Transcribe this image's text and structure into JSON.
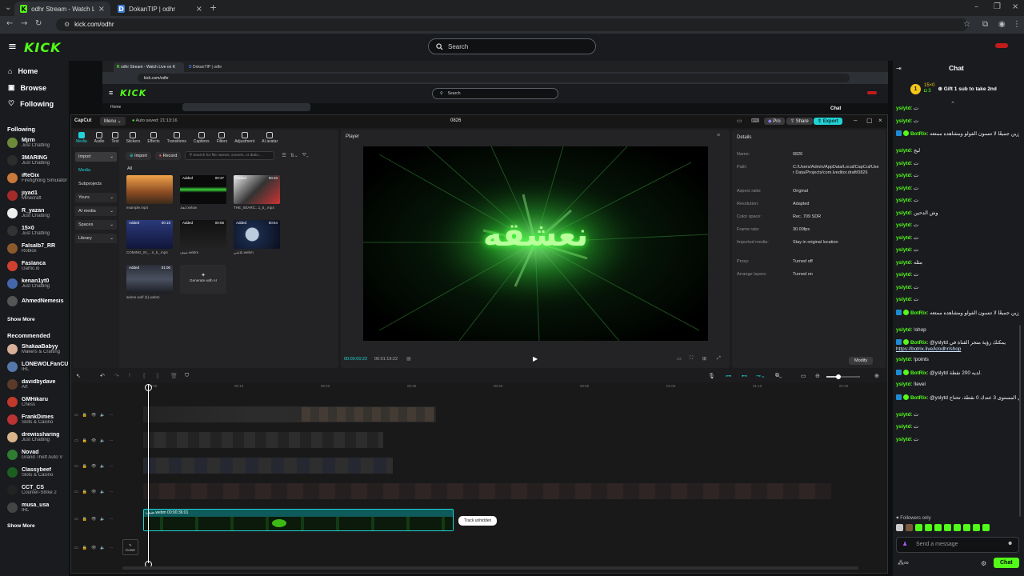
{
  "browser": {
    "tabs": [
      {
        "title": "odhr Stream - Watch Live on Kick",
        "active": true
      },
      {
        "title": "DokanTIP | odhr",
        "active": false
      }
    ],
    "url": "kick.com/odhr"
  },
  "kick": {
    "logo": "KICK",
    "search_placeholder": "Search",
    "nav": [
      "Home",
      "Browse",
      "Following"
    ],
    "following_title": "Following",
    "following": [
      {
        "name": "Mjrm",
        "category": "Just Chatting",
        "color": "#6d8a3a"
      },
      {
        "name": "3MARING",
        "category": "Just Chatting",
        "color": "#2c2c2c"
      },
      {
        "name": "iReGix",
        "category": "Firefighting Simulator",
        "color": "#c97a3a"
      },
      {
        "name": "jiyad1",
        "category": "Minecraft",
        "color": "#a52a2a"
      },
      {
        "name": "R_yazan",
        "category": "Just Chatting",
        "color": "#eeeeee"
      },
      {
        "name": "15×0",
        "category": "Just Chatting",
        "color": "#333333"
      },
      {
        "name": "Falsalb7_RR",
        "category": "Roblox",
        "color": "#8b5a2b"
      },
      {
        "name": "Faslanca",
        "category": "Gartic.io",
        "color": "#d04030"
      },
      {
        "name": "kenan1yt0",
        "category": "Just Chatting",
        "color": "#4466aa"
      },
      {
        "name": "AhmedNemesis",
        "category": "",
        "color": "#555555"
      }
    ],
    "show_more": "Show More",
    "recommended_title": "Recommended",
    "recommended": [
      {
        "name": "ShakaaBabyy",
        "category": "Makers & Crafting",
        "color": "#d8b09a"
      },
      {
        "name": "LONEWOLFanCU",
        "category": "IRL",
        "color": "#5577aa"
      },
      {
        "name": "davidbydave",
        "category": "Art",
        "color": "#5a3b2a"
      },
      {
        "name": "GMHikaru",
        "category": "Chess",
        "color": "#c0392b"
      },
      {
        "name": "FrankDimes",
        "category": "Slots & Casino",
        "color": "#bb3333"
      },
      {
        "name": "drewissharing",
        "category": "Just Chatting",
        "color": "#d9b58a"
      },
      {
        "name": "Novad",
        "category": "Grand Theft Auto V",
        "color": "#2e7d32"
      },
      {
        "name": "Classybeef",
        "category": "Slots & Casino",
        "color": "#1b5e20"
      },
      {
        "name": "CCT_CS",
        "category": "Counter-Strike 2",
        "color": "#222222"
      },
      {
        "name": "musa_usa",
        "category": "IRL",
        "color": "#444444"
      }
    ],
    "show_more_2": "Show More"
  },
  "inner": {
    "tabs": [
      "odhr Stream - Watch Live on K",
      "DokanTIP | odhr"
    ],
    "url": "kick.com/odhr",
    "search": "Search",
    "home": "Home",
    "chat": "Chat"
  },
  "capcut": {
    "app": "CapCut",
    "menu": "Menu",
    "autosave": "Auto saved: 21:13:16",
    "project": "0826",
    "pro": "Pro",
    "share": "Share",
    "export": "Export",
    "tools": [
      {
        "label": "Media",
        "active": true
      },
      {
        "label": "Audio",
        "active": false
      },
      {
        "label": "Text",
        "active": false
      },
      {
        "label": "Stickers",
        "active": false
      },
      {
        "label": "Effects",
        "active": false
      },
      {
        "label": "Transitions",
        "active": false
      },
      {
        "label": "Captions",
        "active": false
      },
      {
        "label": "Filters",
        "active": false
      },
      {
        "label": "Adjustment",
        "active": false
      },
      {
        "label": "AI avatar",
        "active": false
      }
    ],
    "side": [
      "Import",
      "Media",
      "Subprojects",
      "Yours",
      "AI media",
      "Spaces",
      "Library"
    ],
    "import_btn": "Import",
    "record_btn": "Record",
    "search_placeholder": "Search for file names, scenes, or dialo...",
    "all": "All",
    "media": [
      {
        "added": "",
        "duration": "",
        "name": "example.mp4",
        "tone": "sunset"
      },
      {
        "added": "Added",
        "duration": "00:37",
        "name": "ابعاد.xelow",
        "tone": "greenbeam"
      },
      {
        "added": "Added",
        "duration": "00:10",
        "name": "THE_SEARC...1_5_.mp4",
        "tone": "bw"
      },
      {
        "added": "Added",
        "duration": "00:16",
        "name": "COMING_IN_...ri_5_.mp4",
        "tone": "bluenight"
      },
      {
        "added": "Added",
        "duration": "00:06",
        "name": "ضيف.webm",
        "tone": "dark"
      },
      {
        "added": "Added",
        "duration": "00:54",
        "name": "تلاشي.webm",
        "tone": "moon"
      },
      {
        "added": "Added",
        "duration": "01:00",
        "name": "anime wolf (1).webm",
        "tone": "anime"
      }
    ],
    "generate_ai": "Generate with AI",
    "player_title": "Player",
    "player_text": "نعشقه",
    "time_current": "00:00:00:22",
    "time_total": "00:01:19:22",
    "details_title": "Details",
    "details": [
      {
        "k": "Name:",
        "v": "0826"
      },
      {
        "k": "Path:",
        "v": "C:/Users/Admin/AppData/Local/CapCut/User Data/Projects/com.lveditor.draft/0826"
      },
      {
        "k": "Aspect ratio:",
        "v": "Original"
      },
      {
        "k": "Resolution:",
        "v": "Adapted"
      },
      {
        "k": "Color space:",
        "v": "Rec. 709 SDR"
      },
      {
        "k": "Frame rate:",
        "v": "30.00fps"
      },
      {
        "k": "Imported media:",
        "v": "Stay in original location"
      },
      {
        "k": "Proxy:",
        "v": "Turned off"
      },
      {
        "k": "Arrange layers:",
        "v": "Turned on"
      }
    ],
    "modify": "Modify",
    "ticks": [
      "00:00",
      "00:10",
      "00:20",
      "00:30",
      "00:40",
      "00:50",
      "01:00",
      "01:10",
      "01:20"
    ],
    "tooltip": "Track unhidden",
    "clip_label": "ضيف.webm 00:00:36:01",
    "cover": "Cover"
  },
  "chat": {
    "title": "Chat",
    "pinned_user": "15×0",
    "pinned_count": "3",
    "gift_text": "Gift 1 sub to take 2nd",
    "messages": [
      {
        "user": "yslytd",
        "text": "ت",
        "bot": false
      },
      {
        "user": "yslytd",
        "text": "ت",
        "bot": false
      },
      {
        "user": "BotRix",
        "text": "متوزين جميعًا لا تنسون الفولو ومشاهده ممتعه ♥",
        "bot": true
      },
      {
        "user": "yslytd",
        "text": "ليج",
        "bot": false
      },
      {
        "user": "yslytd",
        "text": "ت",
        "bot": false
      },
      {
        "user": "yslytd",
        "text": "ت",
        "bot": false
      },
      {
        "user": "yslytd",
        "text": "ت",
        "bot": false
      },
      {
        "user": "yslytd",
        "text": "ت",
        "bot": false
      },
      {
        "user": "yslytd",
        "text": "وش الدحين",
        "bot": false
      },
      {
        "user": "yslytd",
        "text": "ت",
        "bot": false
      },
      {
        "user": "yslytd",
        "text": "ت",
        "bot": false
      },
      {
        "user": "yslytd",
        "text": "ت",
        "bot": false
      },
      {
        "user": "yslytd",
        "text": "مثله",
        "bot": false
      },
      {
        "user": "yslytd",
        "text": "ت",
        "bot": false
      },
      {
        "user": "yslytd",
        "text": "ت",
        "bot": false
      },
      {
        "user": "yslytd",
        "text": "ت",
        "bot": false
      },
      {
        "user": "BotRix",
        "text": "متوزين جميعًا لا تنسون الفولو ومشاهده ممتعه ♥",
        "bot": true
      },
      {
        "user": "yslytd",
        "text": "!shop",
        "bot": false
      },
      {
        "user": "BotRix",
        "text": "@yslytd يمكنك رؤية متجر القناة في",
        "bot": true,
        "link": "https://botrix.live/k/odhr/shop"
      },
      {
        "user": "yslytd",
        "text": "!points",
        "bot": false
      },
      {
        "user": "BotRix",
        "text": "@yslytd لديه 200 نقطة.",
        "bot": true
      },
      {
        "user": "yslytd",
        "text": "!level",
        "bot": false
      },
      {
        "user": "BotRix",
        "text": "@yslytd في المستوى 3 عندك 0 نقطة، تحتاج",
        "bot": true
      },
      {
        "user": "yslytd",
        "text": "ت",
        "bot": false
      },
      {
        "user": "yslytd",
        "text": "ت",
        "bot": false
      },
      {
        "user": "yslytd",
        "text": "ت",
        "bot": false
      }
    ],
    "followers_only": "Followers only",
    "input_placeholder": "Send a message",
    "send": "Chat"
  },
  "colors": {
    "kick_green": "#53fc18",
    "capcut_cyan": "#22d3d6"
  }
}
